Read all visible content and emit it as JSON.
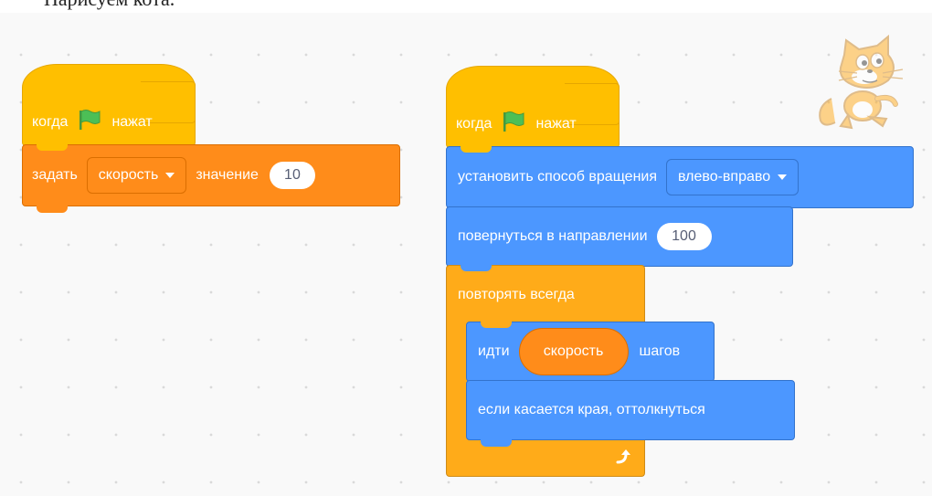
{
  "header": {
    "text": "Нарисуем кота."
  },
  "script1": {
    "hat": {
      "when": "когда",
      "clicked": "нажат",
      "icon": "green-flag-icon"
    },
    "set_block": {
      "set": "задать",
      "variable": "скорость",
      "to": "значение",
      "value": "10"
    }
  },
  "script2": {
    "hat": {
      "when": "когда",
      "clicked": "нажат",
      "icon": "green-flag-icon"
    },
    "rotation": {
      "label": "установить способ вращения",
      "style": "влево-вправо"
    },
    "point": {
      "label": "повернуться в направлении",
      "value": "100"
    },
    "forever": {
      "label": "повторять всегда",
      "icon": "loop-arrow-icon"
    },
    "move": {
      "label": "идти",
      "reporter": "скорость",
      "steps": "шагов"
    },
    "bounce": {
      "label": "если касается края, оттолкнуться"
    }
  },
  "sprite": {
    "icon": "scratch-cat-icon"
  },
  "colors": {
    "events": "#ffbf00",
    "motion": "#4c97ff",
    "variables": "#ff8c1a",
    "control": "#ffab19",
    "flag": "#4cbf56"
  }
}
